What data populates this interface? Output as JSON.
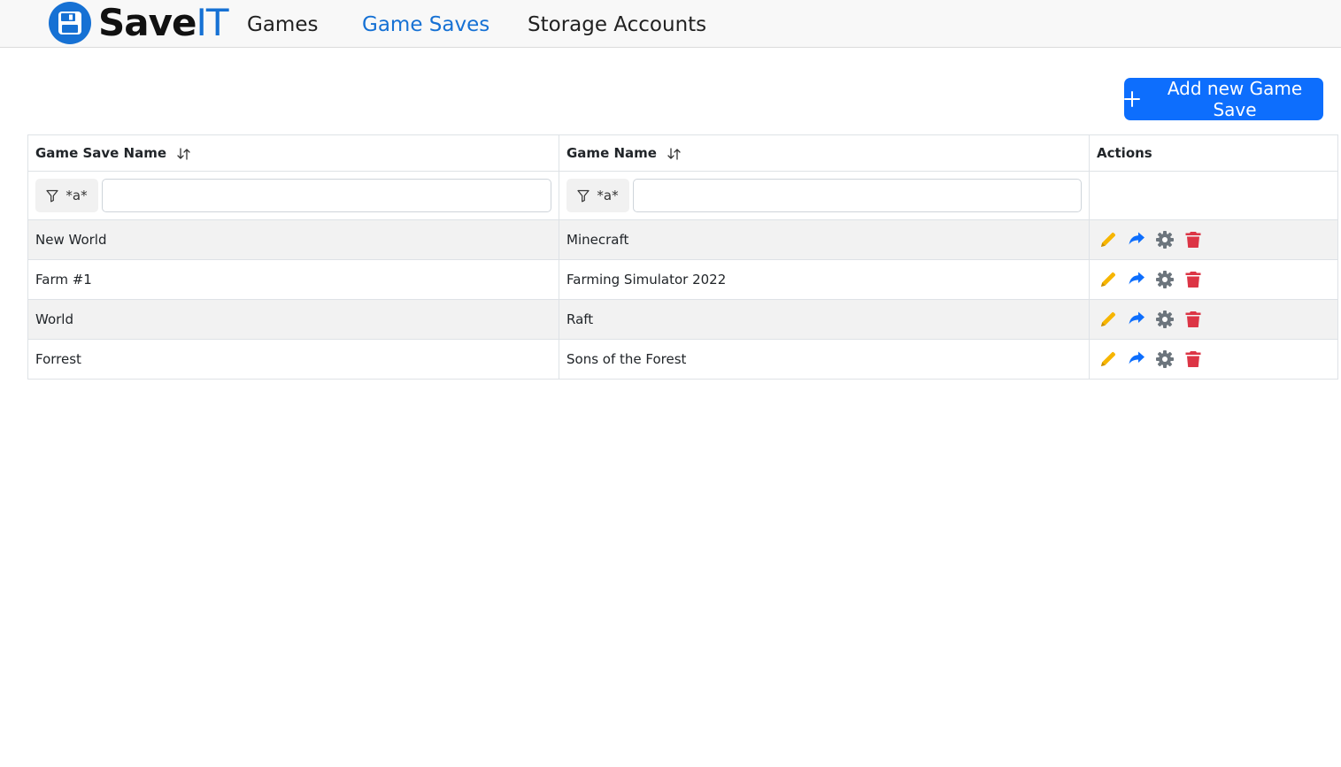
{
  "app": {
    "brand_save": "Save",
    "brand_it": "IT",
    "accent_color": "#1671d4",
    "primary_color": "#0d6efd"
  },
  "nav": {
    "items": [
      {
        "label": "Games",
        "active": false
      },
      {
        "label": "Game Saves",
        "active": true
      },
      {
        "label": "Storage Accounts",
        "active": false
      }
    ]
  },
  "toolbar": {
    "add_label": "Add new Game Save"
  },
  "table": {
    "columns": [
      "Game Save Name",
      "Game Name",
      "Actions"
    ],
    "filter_label": "*a*",
    "filter_values": [
      "",
      ""
    ],
    "rows": [
      {
        "save_name": "New World",
        "game_name": "Minecraft"
      },
      {
        "save_name": "Farm #1",
        "game_name": "Farming Simulator 2022"
      },
      {
        "save_name": "World",
        "game_name": "Raft"
      },
      {
        "save_name": "Forrest",
        "game_name": "Sons of the Forest"
      }
    ],
    "action_icons": [
      "pencil-icon",
      "share-icon",
      "gear-icon",
      "trash-icon"
    ],
    "action_colors": {
      "edit": "#f7b500",
      "share": "#0d6efd",
      "settings": "#6c757d",
      "delete": "#dc3545"
    }
  }
}
